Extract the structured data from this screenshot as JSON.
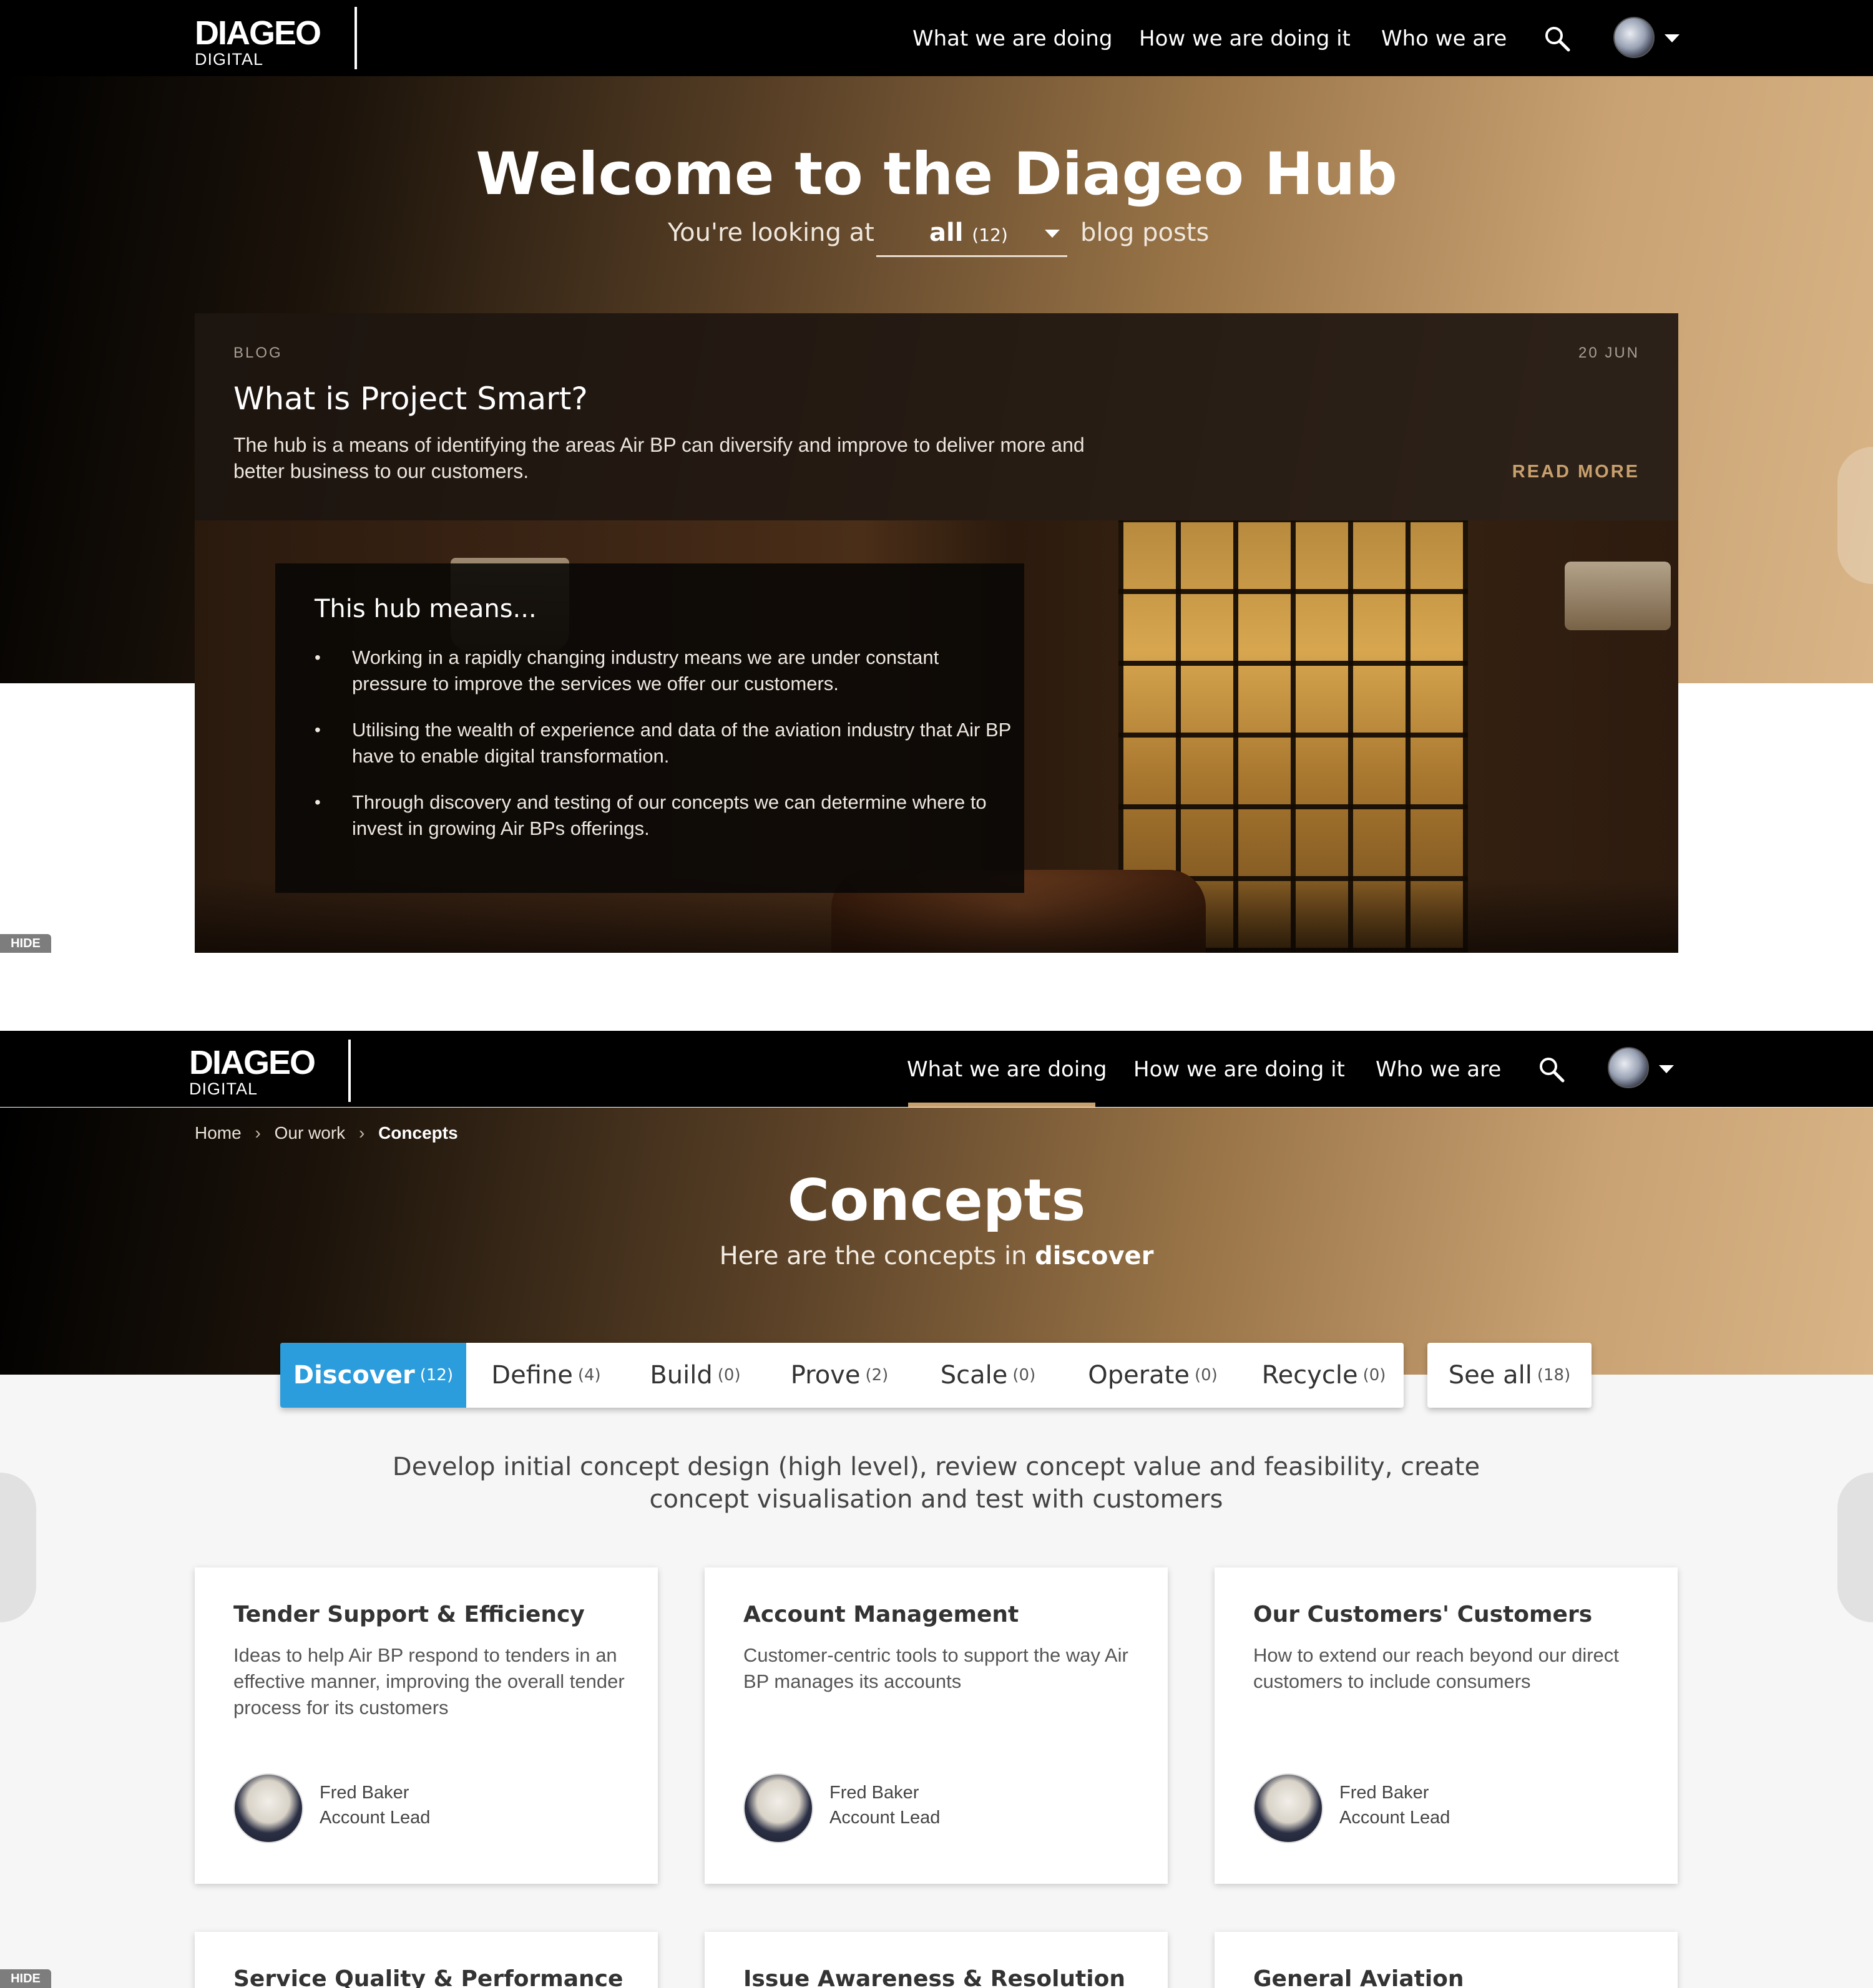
{
  "nav": {
    "logo_main": "DIAGEO",
    "logo_sub": "DIGITAL",
    "links": [
      "What we are doing",
      "How we are doing it",
      "Who we are"
    ],
    "search_icon": "search-icon",
    "avatar_icon": "user-avatar",
    "menu_icon": "chevron-down-icon"
  },
  "blog_page": {
    "title": "Welcome to the Diageo Hub",
    "filter_prefix": "You're looking at",
    "filter_value": "all",
    "filter_count": "(12)",
    "filter_suffix": "blog posts",
    "post": {
      "category": "BLOG",
      "date": "20 JUN",
      "title": "What is Project Smart?",
      "description": "The hub is a means of identifying the areas Air BP can diversify and improve to deliver more and better business to our customers.",
      "cta": "READ MORE"
    },
    "hub_means": {
      "heading": "This hub means...",
      "items": [
        "Working in a rapidly changing industry means we are under constant pressure to improve the services we offer our customers.",
        "Utilising the wealth of experience and data of the aviation industry that Air BP have to enable digital transformation.",
        "Through discovery and testing of our concepts we can determine where to invest in growing Air BPs offerings."
      ]
    },
    "hide_label": "HIDE"
  },
  "concepts_page": {
    "breadcrumb": [
      "Home",
      "Our work",
      "Concepts"
    ],
    "breadcrumb_sep": "›",
    "title": "Concepts",
    "subtitle_prefix": "Here are the concepts in",
    "subtitle_stage": "discover",
    "stages": [
      {
        "label": "Discover",
        "count": "(12)",
        "active": true
      },
      {
        "label": "Define",
        "count": "(4)",
        "active": false
      },
      {
        "label": "Build",
        "count": "(0)",
        "active": false
      },
      {
        "label": "Prove",
        "count": "(2)",
        "active": false
      },
      {
        "label": "Scale",
        "count": "(0)",
        "active": false
      },
      {
        "label": "Operate",
        "count": "(0)",
        "active": false
      },
      {
        "label": "Recycle",
        "count": "(0)",
        "active": false
      }
    ],
    "see_all": {
      "label": "See all",
      "count": "(18)"
    },
    "stage_description": "Develop initial concept design (high level), review concept value and feasibility, create concept visualisation and test with customers",
    "cards": [
      {
        "title": "Tender Support & Efficiency",
        "description": "Ideas to help Air BP respond to tenders in an effective manner, improving the overall tender process for its customers",
        "owner_name": "Fred Baker",
        "owner_role": "Account Lead"
      },
      {
        "title": "Account Management",
        "description": "Customer-centric tools to support the way Air BP manages its accounts",
        "owner_name": "Fred Baker",
        "owner_role": "Account Lead"
      },
      {
        "title": "Our Customers' Customers",
        "description": "How to extend our reach beyond our direct customers to include consumers",
        "owner_name": "Fred Baker",
        "owner_role": "Account Lead"
      }
    ],
    "more_cards": [
      "Service Quality & Performance",
      "Issue Awareness & Resolution",
      "General Aviation"
    ],
    "hide_label": "HIDE"
  },
  "colors": {
    "nav_bg": "#000000",
    "accent_gold": "#c8a06e",
    "active_tab": "#2b9cdc",
    "lower_bg": "#f6f6f6"
  }
}
